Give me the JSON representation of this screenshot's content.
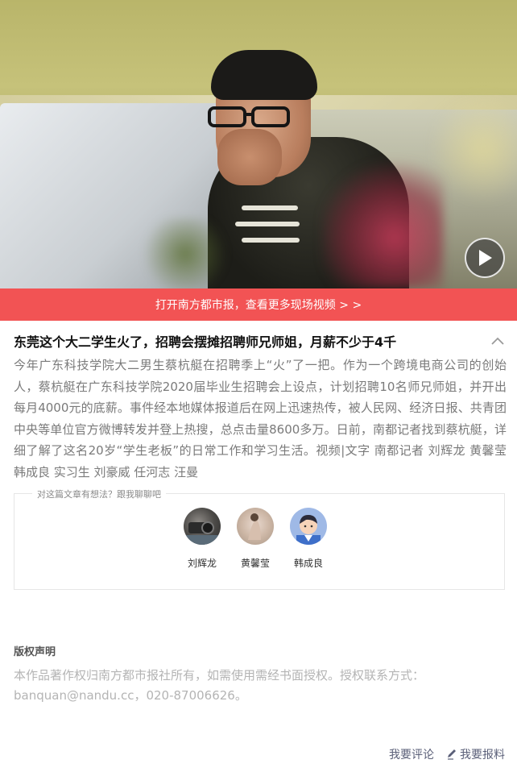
{
  "video": {
    "banner_text": "打开南方都市报，查看更多现场视频 > >"
  },
  "article": {
    "headline": "东莞这个大二学生火了，招聘会摆摊招聘师兄师姐，月薪不少于4千",
    "summary": "今年广东科技学院大二男生蔡杭艇在招聘季上“火”了一把。作为一个跨境电商公司的创始人，蔡杭艇在广东科技学院2020届毕业生招聘会上设点，计划招聘10名师兄师姐，并开出每月4000元的底薪。事件经本地媒体报道后在网上迅速热传，被人民网、经济日报、共青团中央等单位官方微博转发并登上热搜，总点击量8600多万。日前，南都记者找到蔡杭艇，详细了解了这名20岁“学生老板”的日常工作和学习生活。视频|文字 南都记者 刘辉龙 黄馨莹 韩成良 实习生 刘豪威 任河志 汪曼"
  },
  "comment_box": {
    "legend": "对这篇文章有想法？跟我聊聊吧",
    "authors": [
      {
        "name": "刘辉龙"
      },
      {
        "name": "黄馨莹"
      },
      {
        "name": "韩成良"
      }
    ]
  },
  "copyright": {
    "title": "版权声明",
    "text": "本作品著作权归南方都市报社所有，如需使用需经书面授权。授权联系方式：banquan@nandu.cc，020-87006626。"
  },
  "footer": {
    "comment_label": "我要评论",
    "report_label": "我要报料"
  },
  "colors": {
    "banner": "#f25354",
    "footer_link": "#5a5f78"
  }
}
